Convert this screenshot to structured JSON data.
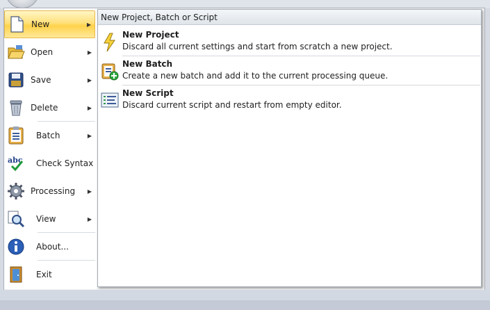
{
  "menu": {
    "items": [
      {
        "label": "New",
        "icon": "new-document-icon",
        "submenu": true
      },
      {
        "label": "Open",
        "icon": "open-folder-icon",
        "submenu": true
      },
      {
        "label": "Save",
        "icon": "save-disk-icon",
        "submenu": true
      },
      {
        "label": "Delete",
        "icon": "trash-can-icon",
        "submenu": true
      },
      {
        "label": "Batch",
        "icon": "batch-clipboard-icon",
        "submenu": true
      },
      {
        "label": "Check Syntax",
        "icon": "spellcheck-icon",
        "submenu": false
      },
      {
        "label": "Processing",
        "icon": "gears-icon",
        "submenu": true
      },
      {
        "label": "View",
        "icon": "magnifier-icon",
        "submenu": true
      },
      {
        "label": "About...",
        "icon": "info-icon",
        "submenu": false
      },
      {
        "label": "Exit",
        "icon": "exit-door-icon",
        "submenu": false
      }
    ],
    "active": "New",
    "arrow": "▶"
  },
  "panel": {
    "title": "New Project, Batch or Script",
    "items": [
      {
        "title": "New Project",
        "description": "Discard all current settings and start from scratch a new project.",
        "icon": "lightning-icon"
      },
      {
        "title": "New Batch",
        "description": "Create a new batch and add it to the current processing queue.",
        "icon": "add-batch-icon"
      },
      {
        "title": "New Script",
        "description": "Discard current script and restart from empty editor.",
        "icon": "script-icon"
      }
    ]
  },
  "colors": {
    "highlight": "#ffd24a",
    "frame": "#d6dbe3"
  }
}
